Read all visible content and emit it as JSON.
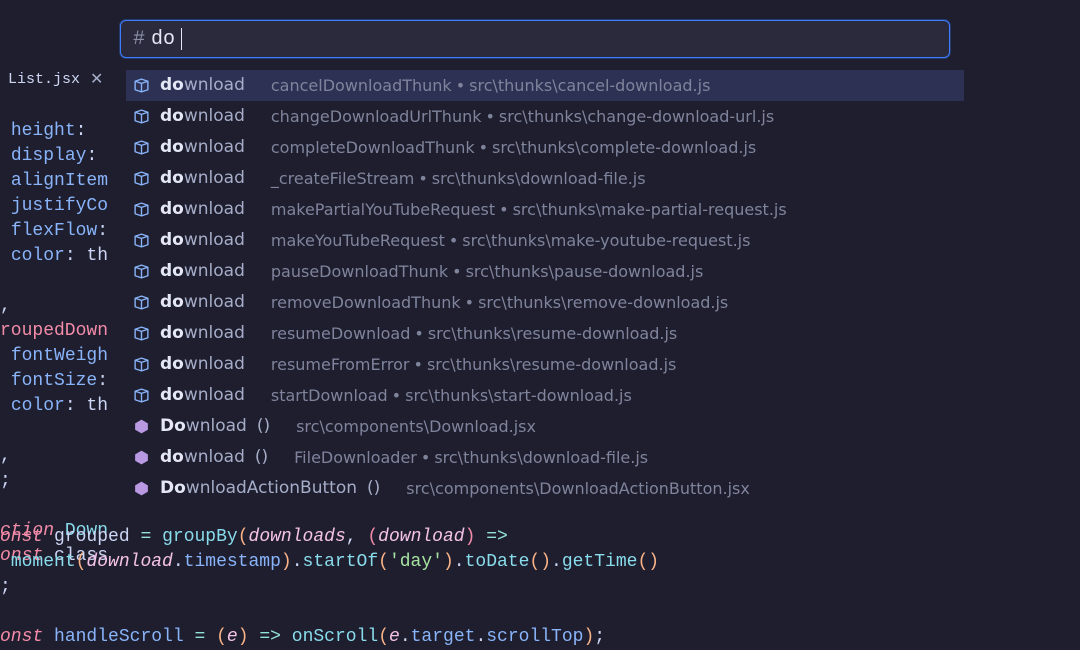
{
  "search": {
    "prefix": "#",
    "value": "do"
  },
  "tab": {
    "filename": "List.jsx"
  },
  "suggestions": [
    {
      "kind": "symbol",
      "term": "download",
      "bold": 2,
      "parens": false,
      "detail": "cancelDownloadThunk",
      "path": "src\\thunks\\cancel-download.js",
      "selected": true
    },
    {
      "kind": "symbol",
      "term": "download",
      "bold": 2,
      "parens": false,
      "detail": "changeDownloadUrlThunk",
      "path": "src\\thunks\\change-download-url.js"
    },
    {
      "kind": "symbol",
      "term": "download",
      "bold": 2,
      "parens": false,
      "detail": "completeDownloadThunk",
      "path": "src\\thunks\\complete-download.js"
    },
    {
      "kind": "symbol",
      "term": "download",
      "bold": 2,
      "parens": false,
      "detail": "_createFileStream",
      "path": "src\\thunks\\download-file.js"
    },
    {
      "kind": "symbol",
      "term": "download",
      "bold": 2,
      "parens": false,
      "detail": "makePartialYouTubeRequest",
      "path": "src\\thunks\\make-partial-request.js"
    },
    {
      "kind": "symbol",
      "term": "download",
      "bold": 2,
      "parens": false,
      "detail": "makeYouTubeRequest",
      "path": "src\\thunks\\make-youtube-request.js"
    },
    {
      "kind": "symbol",
      "term": "download",
      "bold": 2,
      "parens": false,
      "detail": "pauseDownloadThunk",
      "path": "src\\thunks\\pause-download.js"
    },
    {
      "kind": "symbol",
      "term": "download",
      "bold": 2,
      "parens": false,
      "detail": "removeDownloadThunk",
      "path": "src\\thunks\\remove-download.js"
    },
    {
      "kind": "symbol",
      "term": "download",
      "bold": 2,
      "parens": false,
      "detail": "resumeDownload",
      "path": "src\\thunks\\resume-download.js"
    },
    {
      "kind": "symbol",
      "term": "download",
      "bold": 2,
      "parens": false,
      "detail": "resumeFromError",
      "path": "src\\thunks\\resume-download.js"
    },
    {
      "kind": "symbol",
      "term": "download",
      "bold": 2,
      "parens": false,
      "detail": "startDownload",
      "path": "src\\thunks\\start-download.js"
    },
    {
      "kind": "class",
      "term": "Download",
      "bold": 2,
      "parens": true,
      "detail": "",
      "path": "src\\components\\Download.jsx"
    },
    {
      "kind": "class",
      "term": "download",
      "bold": 2,
      "parens": true,
      "detail": "FileDownloader",
      "path": "src\\thunks\\download-file.js"
    },
    {
      "kind": "class",
      "term": "DownloadActionButton",
      "bold": 2,
      "parens": true,
      "detail": "",
      "path": "src\\components\\DownloadActionButton.jsx"
    }
  ],
  "code": {
    "top_lines": [
      "height:",
      "display:",
      "alignItem",
      "justifyCo",
      "flexFlow:",
      "color: th"
    ],
    "mid_lines": [
      "roupedDown",
      " fontWeigh",
      " fontSize:",
      " color: th"
    ]
  }
}
